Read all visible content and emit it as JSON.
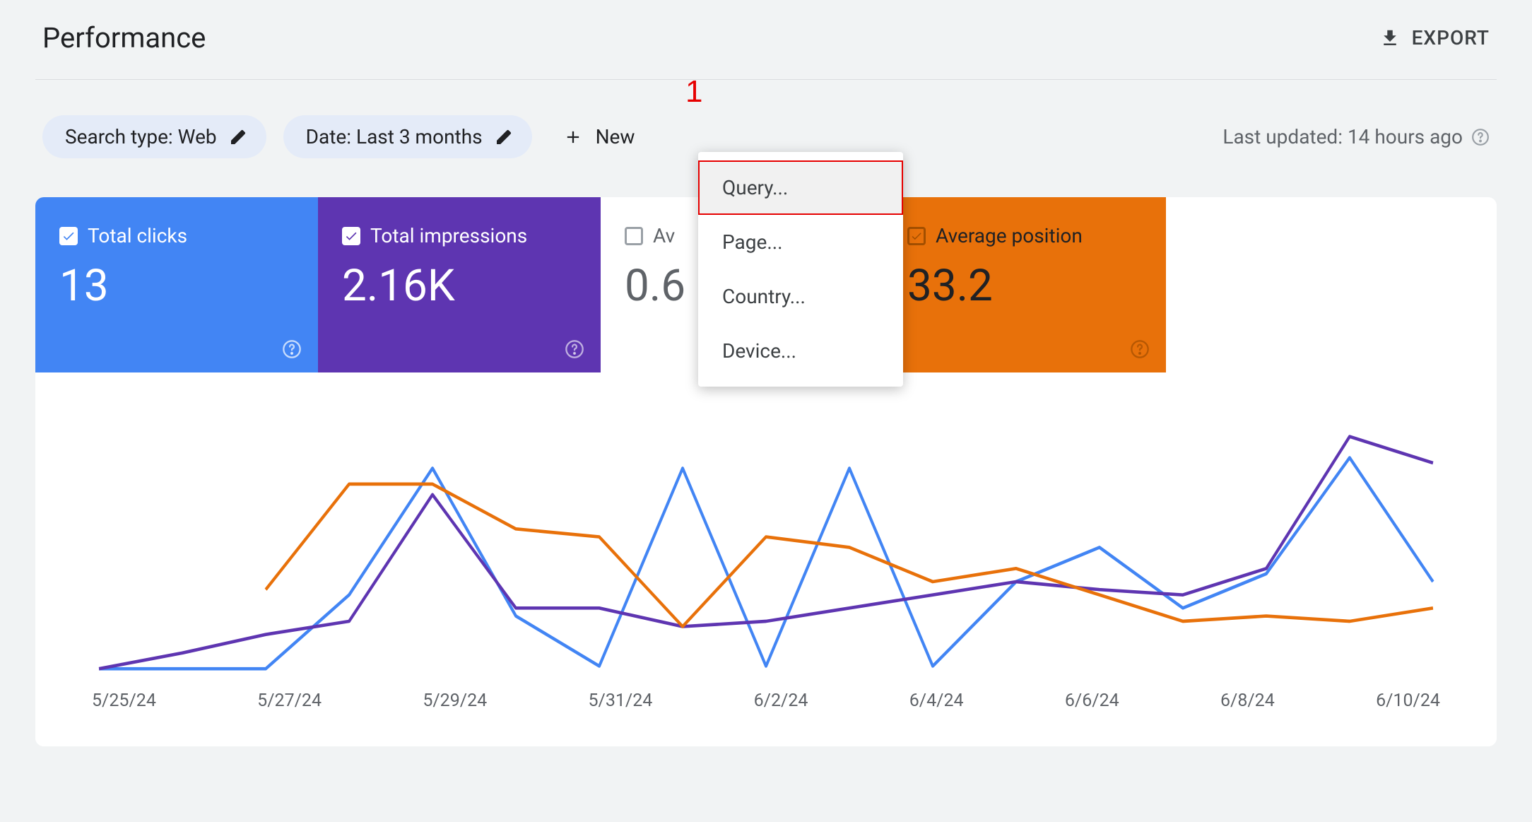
{
  "header": {
    "title": "Performance",
    "export_label": "EXPORT"
  },
  "filters": {
    "search_type": "Search type: Web",
    "date_range": "Date: Last 3 months",
    "new_label": "New",
    "last_updated": "Last updated: 14 hours ago"
  },
  "annotation": {
    "marker1": "1"
  },
  "dropdown": {
    "items": [
      "Query...",
      "Page...",
      "Country...",
      "Device..."
    ]
  },
  "metrics": {
    "clicks": {
      "label": "Total clicks",
      "value": "13",
      "checked": true,
      "color": "#4285f4"
    },
    "impressions": {
      "label": "Total impressions",
      "value": "2.16K",
      "checked": true,
      "color": "#5e35b1"
    },
    "ctr": {
      "label": "Average CTR",
      "value": "0.6",
      "checked": false,
      "color": "#00897b",
      "visible_label_prefix": "Av"
    },
    "position": {
      "label": "Average position",
      "value": "33.2",
      "checked": true,
      "color": "#e8710a"
    }
  },
  "chart_data": {
    "type": "line",
    "x": [
      "5/25/24",
      "5/26/24",
      "5/27/24",
      "5/28/24",
      "5/29/24",
      "5/30/24",
      "5/31/24",
      "6/1/24",
      "6/2/24",
      "6/3/24",
      "6/4/24",
      "6/5/24",
      "6/6/24",
      "6/7/24",
      "6/8/24",
      "6/9/24",
      "6/10/24"
    ],
    "x_ticks": [
      "5/25/24",
      "5/27/24",
      "5/29/24",
      "5/31/24",
      "6/2/24",
      "6/4/24",
      "6/6/24",
      "6/8/24",
      "6/10/24"
    ],
    "ylim": [
      0,
      100
    ],
    "series": [
      {
        "name": "Clicks",
        "color": "#4285f4",
        "values": [
          2,
          2,
          2,
          30,
          78,
          22,
          3,
          78,
          3,
          78,
          3,
          35,
          48,
          25,
          38,
          82,
          35
        ]
      },
      {
        "name": "Impressions",
        "color": "#5e35b1",
        "values": [
          2,
          8,
          15,
          20,
          68,
          25,
          25,
          18,
          20,
          25,
          30,
          35,
          32,
          30,
          40,
          90,
          80
        ]
      },
      {
        "name": "Position",
        "color": "#e8710a",
        "values": [
          null,
          null,
          32,
          72,
          72,
          55,
          52,
          18,
          52,
          48,
          35,
          40,
          30,
          20,
          22,
          20,
          25
        ]
      }
    ]
  }
}
